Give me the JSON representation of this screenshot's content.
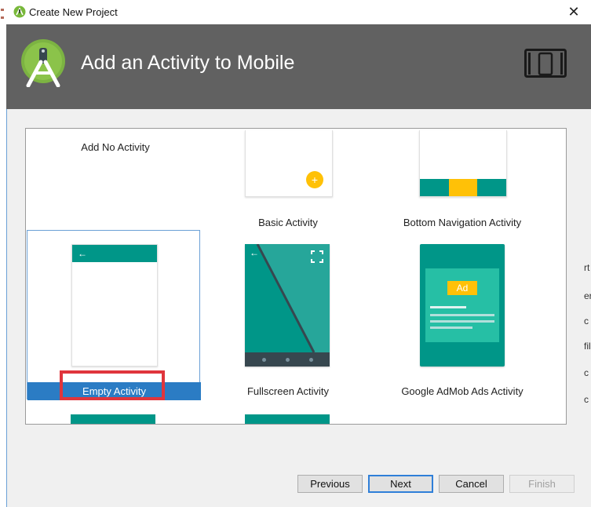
{
  "window": {
    "title": "Create New Project",
    "close_glyph": "✕"
  },
  "header": {
    "title": "Add an Activity to Mobile",
    "logo_icon": "android-studio-logo-icon",
    "device_icon": "phone-tablet-icon"
  },
  "templates": [
    {
      "label": "Add No Activity"
    },
    {
      "label": "Basic Activity",
      "fab_glyph": "+"
    },
    {
      "label": "Bottom Navigation Activity"
    },
    {
      "label": "Empty Activity",
      "selected": true,
      "back_glyph": "←"
    },
    {
      "label": "Fullscreen Activity",
      "back_glyph": "←"
    },
    {
      "label": "Google AdMob Ads Activity",
      "ad_badge": "Ad"
    }
  ],
  "right_edge_text": [
    "rt",
    "er",
    "c",
    "fil",
    "c",
    "c"
  ],
  "buttons": {
    "previous": "Previous",
    "next": "Next",
    "cancel": "Cancel",
    "finish": "Finish"
  },
  "colors": {
    "teal": "#009688",
    "teal_dark": "#00897b",
    "header": "#616161",
    "selection": "#2b7cc4",
    "highlight_box": "#e0353c",
    "amber": "#ffc107"
  }
}
